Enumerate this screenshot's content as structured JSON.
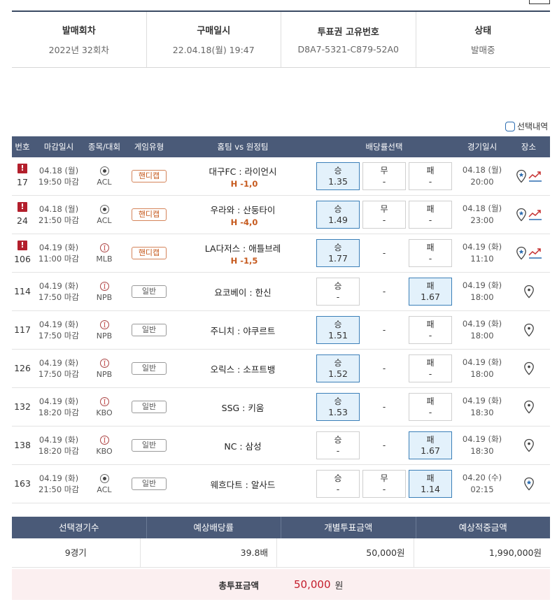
{
  "info": {
    "cells": [
      {
        "label": "발매회차",
        "value": "2022년 32회차"
      },
      {
        "label": "구매일시",
        "value": "22.04.18(월) 19:47"
      },
      {
        "label": "투표권 고유번호",
        "value": "D8A7-5321-C879-52A0"
      },
      {
        "label": "상태",
        "value": "발매중"
      }
    ]
  },
  "select_history": "선택내역",
  "table": {
    "headers": [
      "번호",
      "마감일시",
      "종목/대회",
      "게임유형",
      "홈팀 vs 원정팀",
      "배당률선택",
      "경기일시",
      "장소"
    ],
    "rows": [
      {
        "no": "17",
        "warn": true,
        "deadline_date": "04.18 (월)",
        "deadline_time": "19:50 마감",
        "sport": "soccer",
        "league": "ACL",
        "type": "핸디캡",
        "handicap": true,
        "match": "대구FC : 라이언시",
        "hcap": "H -1,0",
        "win": "승",
        "win_v": "1.35",
        "draw": "무",
        "draw_v": "-",
        "lose": "패",
        "lose_v": "-",
        "sel": "win",
        "draw_box": true,
        "game_date": "04.18 (월)",
        "game_time": "20:00",
        "trend": true
      },
      {
        "no": "24",
        "warn": true,
        "deadline_date": "04.18 (월)",
        "deadline_time": "21:50 마감",
        "sport": "soccer",
        "league": "ACL",
        "type": "핸디캡",
        "handicap": true,
        "match": "우라와 : 산둥타이",
        "hcap": "H -4,0",
        "win": "승",
        "win_v": "1.49",
        "draw": "무",
        "draw_v": "-",
        "lose": "패",
        "lose_v": "-",
        "sel": "win",
        "draw_box": true,
        "game_date": "04.18 (월)",
        "game_time": "23:00",
        "trend": true
      },
      {
        "no": "106",
        "warn": true,
        "deadline_date": "04.19 (화)",
        "deadline_time": "11:00 마감",
        "sport": "base",
        "league": "MLB",
        "type": "핸디캡",
        "handicap": true,
        "match": "LA다저스 : 애틀브레",
        "hcap": "H -1,5",
        "win": "승",
        "win_v": "1.77",
        "draw": "",
        "draw_v": "-",
        "lose": "패",
        "lose_v": "-",
        "sel": "win",
        "draw_box": false,
        "game_date": "04.19 (화)",
        "game_time": "11:10",
        "trend": true
      },
      {
        "no": "114",
        "warn": false,
        "deadline_date": "04.19 (화)",
        "deadline_time": "17:50 마감",
        "sport": "base",
        "league": "NPB",
        "type": "일반",
        "handicap": false,
        "match": "요코베이 : 한신",
        "hcap": "",
        "win": "승",
        "win_v": "-",
        "draw": "",
        "draw_v": "-",
        "lose": "패",
        "lose_v": "1.67",
        "sel": "lose",
        "draw_box": false,
        "game_date": "04.19 (화)",
        "game_time": "18:00",
        "trend": false
      },
      {
        "no": "117",
        "warn": false,
        "deadline_date": "04.19 (화)",
        "deadline_time": "17:50 마감",
        "sport": "base",
        "league": "NPB",
        "type": "일반",
        "handicap": false,
        "match": "주니치 : 야쿠르트",
        "hcap": "",
        "win": "승",
        "win_v": "1.51",
        "draw": "",
        "draw_v": "-",
        "lose": "패",
        "lose_v": "-",
        "sel": "win",
        "draw_box": false,
        "game_date": "04.19 (화)",
        "game_time": "18:00",
        "trend": false
      },
      {
        "no": "126",
        "warn": false,
        "deadline_date": "04.19 (화)",
        "deadline_time": "17:50 마감",
        "sport": "base",
        "league": "NPB",
        "type": "일반",
        "handicap": false,
        "match": "오릭스 : 소프트뱅",
        "hcap": "",
        "win": "승",
        "win_v": "1.52",
        "draw": "",
        "draw_v": "-",
        "lose": "패",
        "lose_v": "-",
        "sel": "win",
        "draw_box": false,
        "game_date": "04.19 (화)",
        "game_time": "18:00",
        "trend": false
      },
      {
        "no": "132",
        "warn": false,
        "deadline_date": "04.19 (화)",
        "deadline_time": "18:20 마감",
        "sport": "base",
        "league": "KBO",
        "type": "일반",
        "handicap": false,
        "match": "SSG : 키움",
        "hcap": "",
        "win": "승",
        "win_v": "1.53",
        "draw": "",
        "draw_v": "-",
        "lose": "패",
        "lose_v": "-",
        "sel": "win",
        "draw_box": false,
        "game_date": "04.19 (화)",
        "game_time": "18:30",
        "trend": false
      },
      {
        "no": "138",
        "warn": false,
        "deadline_date": "04.19 (화)",
        "deadline_time": "18:20 마감",
        "sport": "base",
        "league": "KBO",
        "type": "일반",
        "handicap": false,
        "match": "NC : 삼성",
        "hcap": "",
        "win": "승",
        "win_v": "-",
        "draw": "",
        "draw_v": "-",
        "lose": "패",
        "lose_v": "1.67",
        "sel": "lose",
        "draw_box": false,
        "game_date": "04.19 (화)",
        "game_time": "18:30",
        "trend": false
      },
      {
        "no": "163",
        "warn": false,
        "deadline_date": "04.19 (화)",
        "deadline_time": "21:50 마감",
        "sport": "soccer",
        "league": "ACL",
        "type": "일반",
        "handicap": false,
        "match": "웨흐다트 : 알사드",
        "hcap": "",
        "win": "승",
        "win_v": "-",
        "draw": "무",
        "draw_v": "-",
        "lose": "패",
        "lose_v": "1.14",
        "sel": "lose",
        "draw_box": true,
        "game_date": "04.20 (수)",
        "game_time": "02:15",
        "trend": false,
        "star_only": true
      }
    ]
  },
  "summary": {
    "headers": [
      "선택경기수",
      "예상배당률",
      "개별투표금액",
      "예상적중금액"
    ],
    "values": [
      "9경기",
      "39.8배",
      "50,000원",
      "1,990,000원"
    ],
    "total_label": "총투표금액",
    "total_value": "50,000",
    "total_unit": "원"
  },
  "colors": {
    "header_bg": "#4a5a78",
    "selected_odds_bg": "#e3f1fb",
    "handicap": "#c65a1e",
    "warning": "#b31f2c",
    "total_bg": "#fbeff0"
  }
}
